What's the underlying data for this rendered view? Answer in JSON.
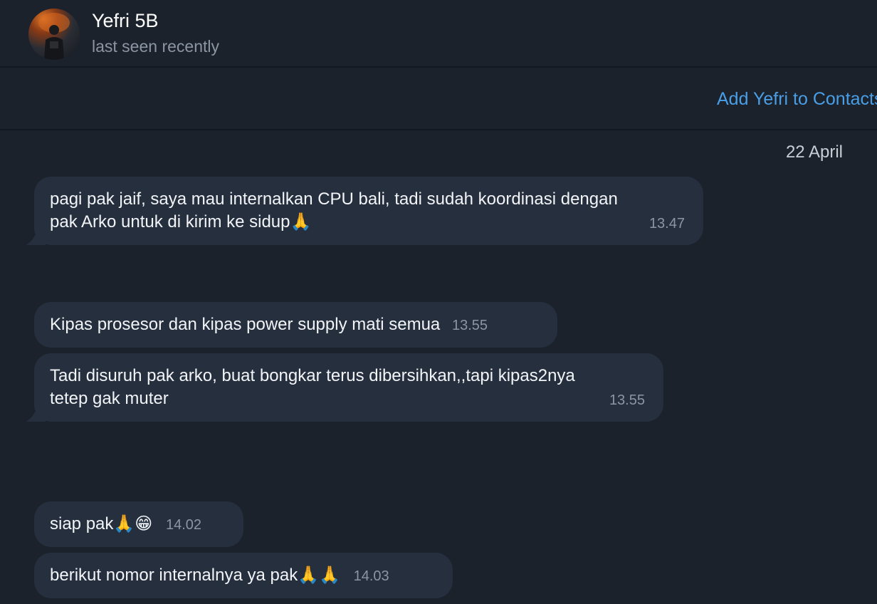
{
  "header": {
    "name": "Yefri 5B",
    "status": "last seen recently"
  },
  "add_contact_label": "Add Yefri to Contacts",
  "date_label": "22 April",
  "messages": [
    {
      "text": "pagi pak jaif, saya mau internalkan CPU bali, tadi sudah koordinasi dengan\npak Arko untuk di kirim ke sidup🙏",
      "time": "13.47"
    },
    {
      "text": "Kipas prosesor dan kipas power supply mati semua",
      "time": "13.55"
    },
    {
      "text": "Tadi disuruh pak arko, buat bongkar terus dibersihkan,,tapi kipas2nya\ntetep gak muter",
      "time": "13.55"
    },
    {
      "text": "siap pak🙏😁",
      "time": "14.02"
    },
    {
      "text": "berikut nomor internalnya ya pak🙏🙏",
      "time": "14.03"
    }
  ],
  "colors": {
    "background": "#1b222c",
    "bubble": "#252f3e",
    "accent": "#4a9ee6",
    "muted": "#8c96a3"
  }
}
